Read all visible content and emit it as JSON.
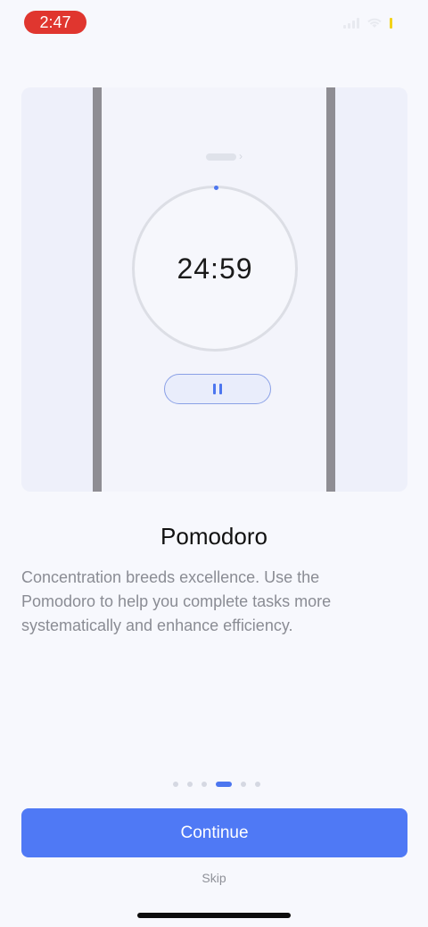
{
  "status_bar": {
    "time": "2:47",
    "icons": [
      "signal-icon",
      "wifi-icon",
      "battery-icon"
    ]
  },
  "illustration": {
    "timer": "24:59",
    "pause_icon": "pause-icon"
  },
  "content": {
    "title": "Pomodoro",
    "description": "Concentration breeds excellence. Use the Pomodoro to help you complete tasks more systematically and enhance efficiency."
  },
  "pager": {
    "count": 6,
    "active_index": 3
  },
  "actions": {
    "continue_label": "Continue",
    "skip_label": "Skip"
  },
  "colors": {
    "accent": "#4f79f5",
    "background": "#f7f8fd",
    "status_time_bg": "#e0362f"
  }
}
